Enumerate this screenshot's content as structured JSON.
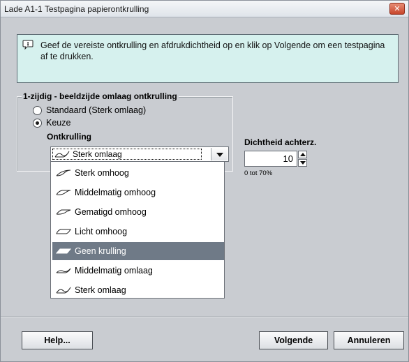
{
  "window": {
    "title": "Lade A1-1 Testpagina papierontkrulling",
    "close_glyph": "✕"
  },
  "info": {
    "icon": "speech-bubble-info-icon",
    "text": "Geef de vereiste ontkrulling en afdrukdichtheid op en klik op Volgende om een testpagina af te drukken."
  },
  "group": {
    "legend": "1-zijdig - beeldzijde omlaag ontkrulling",
    "options": [
      {
        "label": "Standaard (Sterk omlaag)",
        "checked": false
      },
      {
        "label": "Keuze",
        "checked": true
      }
    ]
  },
  "curl": {
    "label": "Ontkrulling",
    "selected_value": "Sterk omlaag",
    "selected_icon": "curl-strong-down-icon",
    "options": [
      {
        "label": "Sterk omhoog",
        "icon": "curl-strong-up-icon",
        "highlighted": false
      },
      {
        "label": "Middelmatig omhoog",
        "icon": "curl-medium-up-icon",
        "highlighted": false
      },
      {
        "label": "Gematigd omhoog",
        "icon": "curl-moderate-up-icon",
        "highlighted": false
      },
      {
        "label": "Licht omhoog",
        "icon": "curl-light-up-icon",
        "highlighted": false
      },
      {
        "label": "Geen krulling",
        "icon": "curl-none-icon",
        "highlighted": true
      },
      {
        "label": "Middelmatig omlaag",
        "icon": "curl-medium-down-icon",
        "highlighted": false
      },
      {
        "label": "Sterk omlaag",
        "icon": "curl-strong-down-icon",
        "highlighted": false
      }
    ]
  },
  "density": {
    "label": "Dichtheid achterz.",
    "value": "10",
    "range": "0 tot 70%"
  },
  "buttons": {
    "help": "Help...",
    "next": "Volgende",
    "cancel": "Annuleren"
  },
  "colors": {
    "window_bg": "#c9ccd1",
    "info_bg": "#d6f1ee",
    "selection_bg": "#6f7a87",
    "close_red": "#c7452b"
  }
}
